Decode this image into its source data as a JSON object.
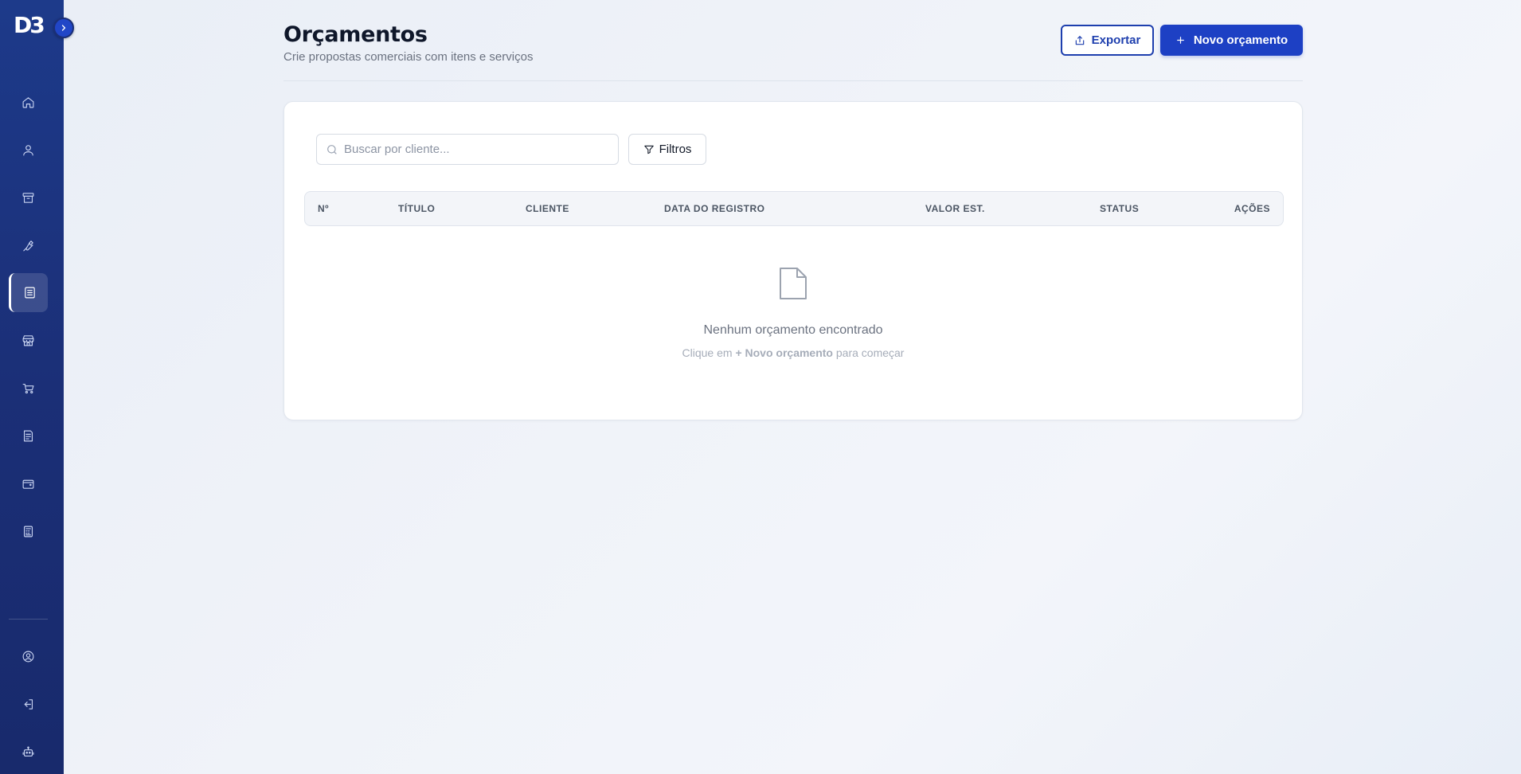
{
  "sidebar": {
    "logo": "D3",
    "items": [
      {
        "icon": "home-icon"
      },
      {
        "icon": "user-icon"
      },
      {
        "icon": "archive-icon"
      },
      {
        "icon": "wrench-icon"
      },
      {
        "icon": "spreadsheet-icon",
        "active": true
      },
      {
        "icon": "store-icon"
      },
      {
        "icon": "cart-icon"
      },
      {
        "icon": "invoice-icon"
      },
      {
        "icon": "wallet-icon"
      },
      {
        "icon": "calculator-icon"
      }
    ],
    "bottom_items": [
      {
        "icon": "user-circle-icon"
      },
      {
        "icon": "logout-icon"
      },
      {
        "icon": "bot-icon"
      }
    ]
  },
  "header": {
    "title": "Orçamentos",
    "subtitle": "Crie propostas comerciais com itens e serviços",
    "export_label": "Exportar",
    "new_label": "Novo orçamento"
  },
  "toolbar": {
    "search_placeholder": "Buscar por cliente...",
    "filter_label": "Filtros"
  },
  "table": {
    "columns": [
      "Nº",
      "TÍTULO",
      "CLIENTE",
      "DATA DO REGISTRO",
      "VALOR EST.",
      "STATUS",
      "AÇÕES"
    ],
    "rows": []
  },
  "empty_state": {
    "title": "Nenhum orçamento encontrado",
    "hint_prefix": "Clique em",
    "hint_emphasis": "+ Novo orçamento",
    "hint_suffix": "para começar"
  },
  "colors": {
    "sidebar": "#1b2f77",
    "primary": "#1d40c4",
    "background": "#eef2f8"
  }
}
